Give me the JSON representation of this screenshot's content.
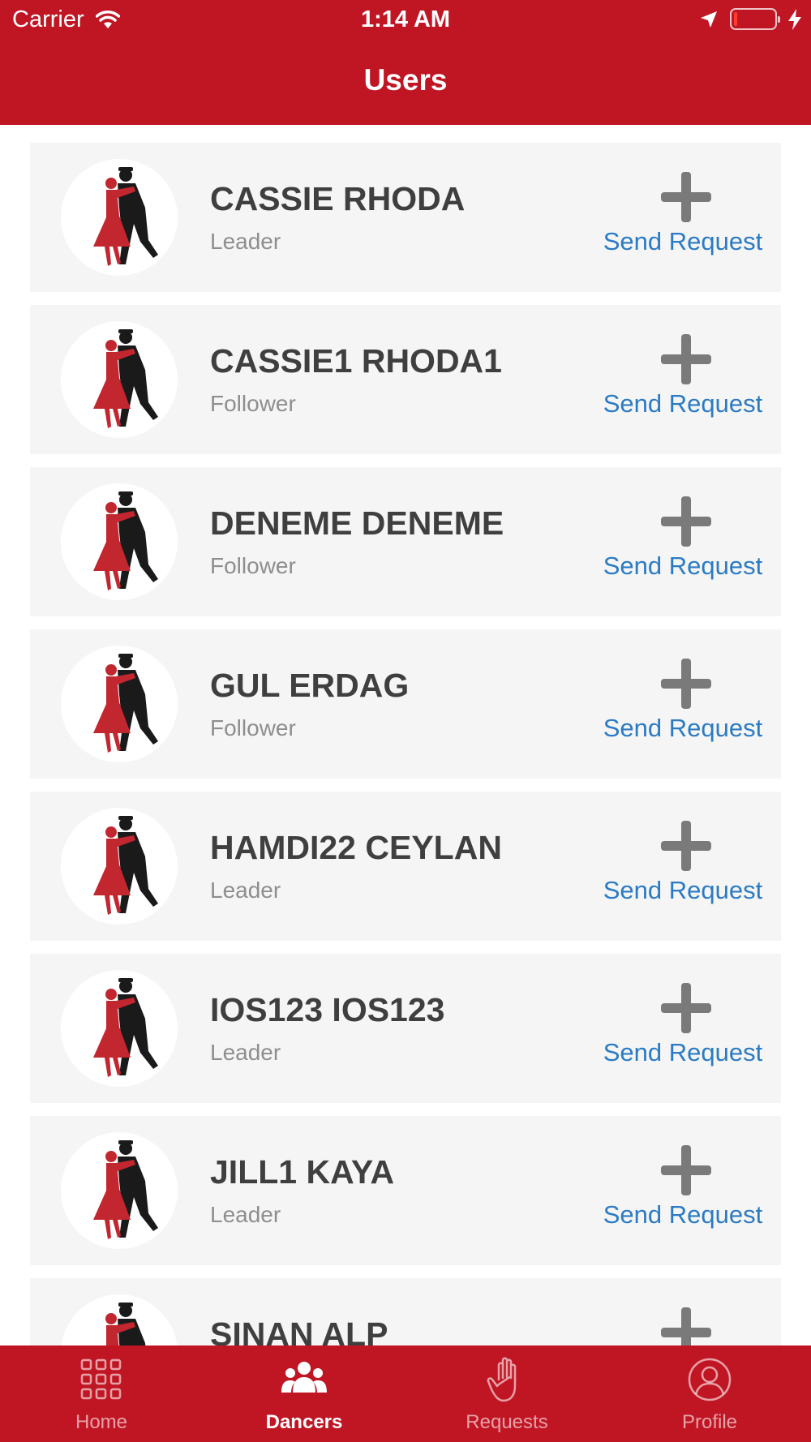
{
  "status_bar": {
    "carrier": "Carrier",
    "time": "1:14 AM"
  },
  "header": {
    "title": "Users"
  },
  "users": [
    {
      "name": "CASSIE RHODA",
      "role": "Leader",
      "action": "Send Request"
    },
    {
      "name": "CASSIE1 RHODA1",
      "role": "Follower",
      "action": "Send Request"
    },
    {
      "name": "DENEME DENEME",
      "role": "Follower",
      "action": "Send Request"
    },
    {
      "name": "GUL ERDAG",
      "role": "Follower",
      "action": "Send Request"
    },
    {
      "name": "HAMDI22 CEYLAN",
      "role": "Leader",
      "action": "Send Request"
    },
    {
      "name": "IOS123 IOS123",
      "role": "Leader",
      "action": "Send Request"
    },
    {
      "name": "JILL1 KAYA",
      "role": "Leader",
      "action": "Send Request"
    },
    {
      "name": "SINAN ALP",
      "role": "",
      "action": ""
    }
  ],
  "tabbar": {
    "tabs": [
      {
        "label": "Home",
        "icon": "grid-icon",
        "active": false
      },
      {
        "label": "Dancers",
        "icon": "dancers-icon",
        "active": true
      },
      {
        "label": "Requests",
        "icon": "hand-icon",
        "active": false
      },
      {
        "label": "Profile",
        "icon": "profile-icon",
        "active": false
      }
    ]
  },
  "colors": {
    "brand_red": "#c01624",
    "link_blue": "#2b7bc4",
    "card_bg": "#f5f5f5"
  }
}
